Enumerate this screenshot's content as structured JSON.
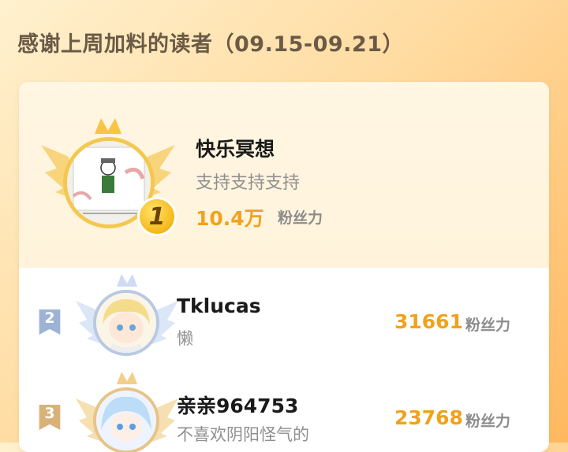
{
  "header": {
    "title": "感谢上周加料的读者（09.15-09.21）"
  },
  "first": {
    "rank": "1",
    "name": "快乐冥想",
    "message": "支持支持支持",
    "score": "10.4万",
    "unit": "粉丝力"
  },
  "rows": [
    {
      "rank": "2",
      "name": "Tklucas",
      "message": "懒",
      "score": "31661",
      "unit": "粉丝力"
    },
    {
      "rank": "3",
      "name": "亲亲964753",
      "message": "不喜欢阴阳怪气的",
      "score": "23768",
      "unit": "粉丝力"
    }
  ],
  "colors": {
    "accent": "#f0a21c",
    "gold": "#f5b81a",
    "silver": "#9db3d6",
    "bronze": "#d9b27a"
  }
}
